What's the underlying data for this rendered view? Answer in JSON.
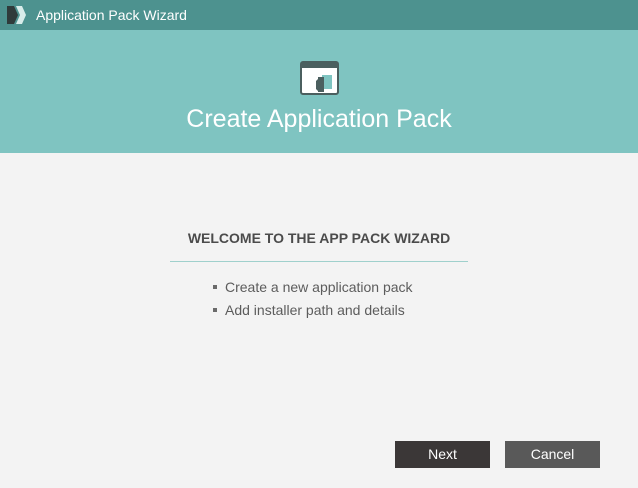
{
  "window": {
    "title": "Application Pack Wizard",
    "icon": "app-pack-logo-icon"
  },
  "banner": {
    "icon": "window-hand-icon",
    "title": "Create Application Pack",
    "background_color": "#7fc4c1"
  },
  "content": {
    "heading": "WELCOME TO THE APP PACK WIZARD",
    "bullets": [
      "Create a new application pack",
      "Add installer path and details"
    ]
  },
  "buttons": {
    "next_label": "Next",
    "cancel_label": "Cancel"
  },
  "colors": {
    "titlebar": "#4d928f",
    "accent_line": "#9fd0cc",
    "next_button": "#3b3737",
    "cancel_button": "#595959"
  }
}
